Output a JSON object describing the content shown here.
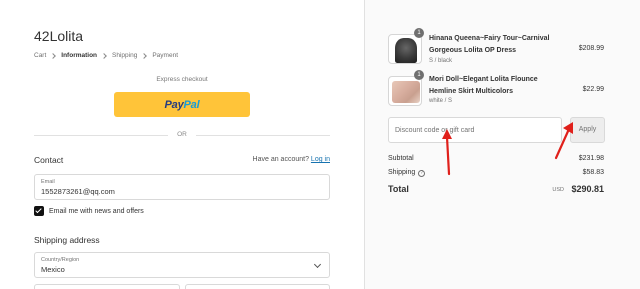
{
  "shop": {
    "name": "42Lolita"
  },
  "breadcrumb": [
    {
      "label": "Cart"
    },
    {
      "label": "Information"
    },
    {
      "label": "Shipping"
    },
    {
      "label": "Payment"
    }
  ],
  "express": {
    "label": "Express checkout",
    "paypal_part1": "Pay",
    "paypal_part2": "Pal"
  },
  "divider": {
    "or": "OR"
  },
  "contact": {
    "title": "Contact",
    "account_prompt": "Have an account?",
    "login_link": "Log in",
    "email_label": "Email",
    "email_value": "1552873261@qq.com",
    "newsletter_label": "Email me with news and offers",
    "newsletter_checked": true
  },
  "shipping": {
    "title": "Shipping address",
    "country_label": "Country/Region",
    "country_value": "Mexico"
  },
  "cart": {
    "items": [
      {
        "name_line1": "Hinana Queena~Fairy Tour~Carnival",
        "name_line2": "Gorgeous Lolita OP Dress",
        "variant": "S / black",
        "price": "$208.99",
        "quantity": "1"
      },
      {
        "name_line1": "Mori Doll~Elegant Lolita Flounce",
        "name_line2": "Hemline Skirt Multicolors",
        "variant": "white / S",
        "price": "$22.99",
        "quantity": "1"
      }
    ]
  },
  "discount": {
    "placeholder": "Discount code or gift card",
    "apply_label": "Apply"
  },
  "summary": {
    "subtotal_label": "Subtotal",
    "subtotal_value": "$231.98",
    "shipping_label": "Shipping",
    "shipping_value": "$58.83",
    "total_label": "Total",
    "currency": "USD",
    "total_value": "$290.81"
  },
  "colors": {
    "annotation_arrow": "#e0201b",
    "paypal_yellow": "#ffc439",
    "link_blue": "#1773b0"
  }
}
